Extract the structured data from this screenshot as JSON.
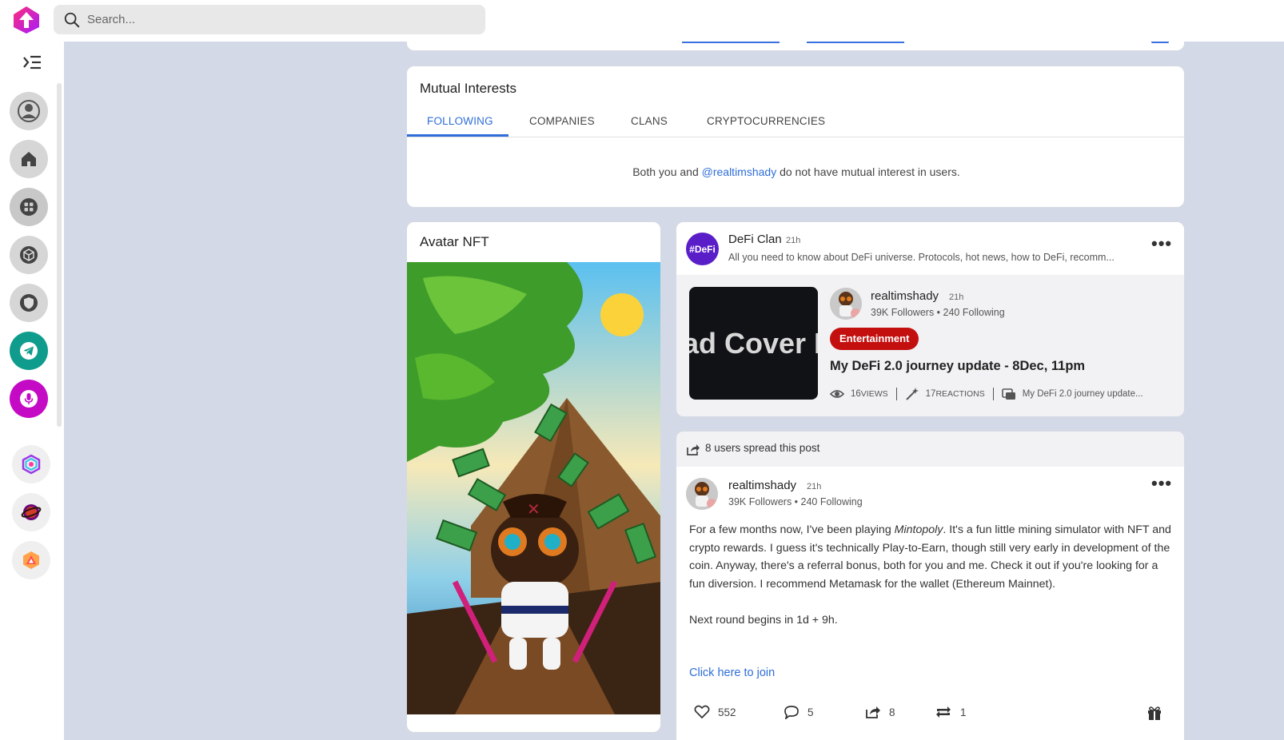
{
  "search": {
    "placeholder": "Search..."
  },
  "sidebar": {
    "items": [
      {
        "icon": "user-icon"
      },
      {
        "icon": "home-icon"
      },
      {
        "icon": "apps-grid-icon"
      },
      {
        "icon": "cube-icon"
      },
      {
        "icon": "shield-icon"
      },
      {
        "icon": "telegram-icon",
        "color": "#0f9c8c"
      },
      {
        "icon": "microphone-icon",
        "color": "#c40ac4"
      },
      {
        "icon": "hexagon-app-icon"
      },
      {
        "icon": "planet-app-icon"
      },
      {
        "icon": "triangle-app-icon"
      }
    ]
  },
  "mutual": {
    "title": "Mutual Interests",
    "tabs": [
      "FOLLOWING",
      "COMPANIES",
      "CLANS",
      "CRYPTOCURRENCIES"
    ],
    "active_tab": "FOLLOWING",
    "message_prefix": "Both you and ",
    "message_user": "@realtimshady",
    "message_suffix": " do not have mutual interest in users."
  },
  "avatar_nft": {
    "title": "Avatar NFT"
  },
  "defi_post": {
    "clan_logo": "#DeFi",
    "clan_name": "DeFi Clan",
    "time": "21h",
    "description": "All you need to know about DeFi universe. Protocols, hot news, how to DeFi, recomm...",
    "thumbnail_text": "ad Cover P",
    "author": "realtimshady",
    "author_time": "21h",
    "followers": "39K Followers",
    "following": "240 Following",
    "category": "Entertainment",
    "title": "My DeFi 2.0 journey update - 8Dec, 11pm",
    "views": "16",
    "views_label": "VIEWS",
    "reactions": "17",
    "reactions_label": "REACTIONS",
    "link_text": "My DeFi 2.0 journey update..."
  },
  "spread_post": {
    "spread_text": "8 users spread this post",
    "author": "realtimshady",
    "time": "21h",
    "followers": "39K Followers",
    "following": "240 Following",
    "body_1": "For a few months now, I've been playing ",
    "body_game": "Mintopoly",
    "body_2": ". It's a fun little mining simulator with NFT and crypto rewards. I guess it's technically Play-to-Earn, though still very early in development of the coin. Anyway, there's a referral bonus, both for you and me. Check it out if you're looking for a fun diversion. I recommend Metamask for the wallet (Ethereum Mainnet).",
    "body_3": "Next round begins in 1d + 9h.",
    "link": "Click here to join",
    "likes": "552",
    "comments": "5",
    "shares": "8",
    "reposts": "1"
  },
  "colors": {
    "accent": "#2f6ed8",
    "badge": "#c40f0f",
    "clan": "#5a1ec8"
  }
}
